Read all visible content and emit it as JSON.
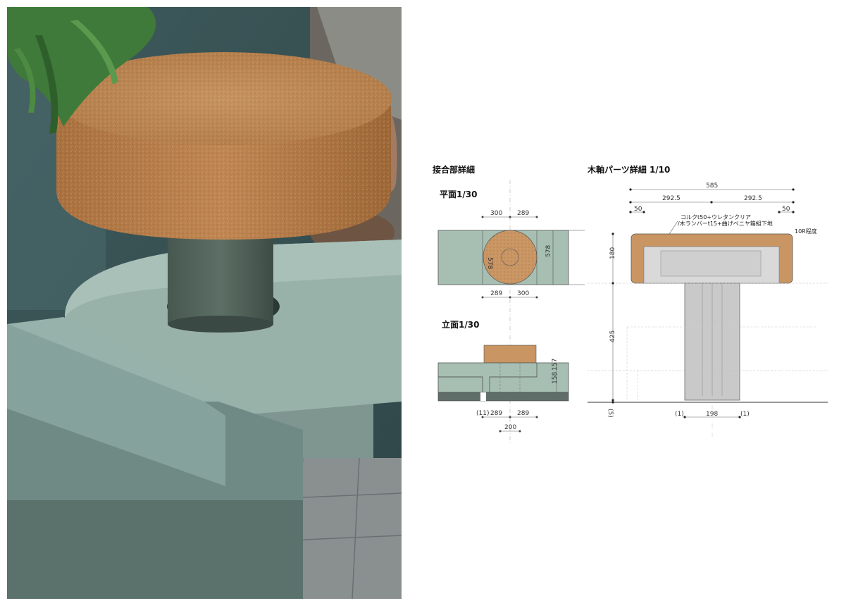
{
  "photo": {
    "subject": "cork-topped-seat-on-green-base"
  },
  "joint_detail": {
    "title": "接合部詳細",
    "plan": {
      "title": "平面1/30",
      "dims_top": [
        "300",
        "289"
      ],
      "dims_bottom": [
        "289",
        "300"
      ],
      "dim_circle": "578",
      "dim_right": "578"
    },
    "elevation": {
      "title": "立面1/30",
      "dim_upper": "157",
      "dim_lower": "158",
      "dims_bottom": [
        "(11)",
        "289",
        "289"
      ],
      "dim_base": "200"
    }
  },
  "wood_detail": {
    "title": "木軸パーツ詳細 1/10",
    "dim_total": "585",
    "dim_half_left": "292.5",
    "dim_half_right": "292.5",
    "dim_edge_left": "50",
    "dim_edge_right": "50",
    "note_line1": "コルクt50+ウレタンクリア",
    "note_line2": "/木ランバーt15+曲げベニヤ箱組下地",
    "note_radius": "10R程度",
    "dim_top_height": "180",
    "dim_leg_height": "425",
    "dim_base_offset": "(5)",
    "dim_leg_width": "198",
    "dim_gap_left": "(1)",
    "dim_gap_right": "(1)"
  },
  "colors": {
    "cork": "#c99563",
    "green": "#a9bfb3",
    "dark_green": "#5f6e69",
    "grey": "#cccccc"
  }
}
